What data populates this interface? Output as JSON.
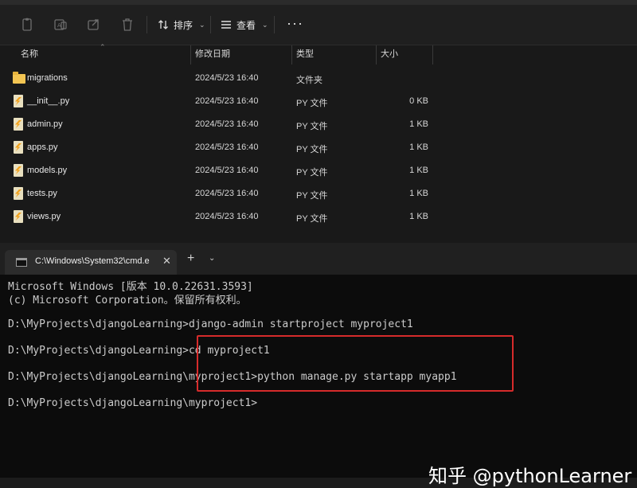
{
  "toolbar": {
    "icons": [
      "cut-icon",
      "copy-icon",
      "share-icon",
      "delete-icon"
    ],
    "sort_label": "排序",
    "view_label": "查看",
    "more_label": "···"
  },
  "columns": {
    "name": "名称",
    "modified": "修改日期",
    "type": "类型",
    "size": "大小"
  },
  "files": [
    {
      "name": "migrations",
      "modified": "2024/5/23 16:40",
      "type": "文件夹",
      "size": "",
      "kind": "folder"
    },
    {
      "name": "__init__.py",
      "modified": "2024/5/23 16:40",
      "type": "PY 文件",
      "size": "0 KB",
      "kind": "py"
    },
    {
      "name": "admin.py",
      "modified": "2024/5/23 16:40",
      "type": "PY 文件",
      "size": "1 KB",
      "kind": "py"
    },
    {
      "name": "apps.py",
      "modified": "2024/5/23 16:40",
      "type": "PY 文件",
      "size": "1 KB",
      "kind": "py"
    },
    {
      "name": "models.py",
      "modified": "2024/5/23 16:40",
      "type": "PY 文件",
      "size": "1 KB",
      "kind": "py"
    },
    {
      "name": "tests.py",
      "modified": "2024/5/23 16:40",
      "type": "PY 文件",
      "size": "1 KB",
      "kind": "py"
    },
    {
      "name": "views.py",
      "modified": "2024/5/23 16:40",
      "type": "PY 文件",
      "size": "1 KB",
      "kind": "py"
    }
  ],
  "terminal": {
    "tab_title": "C:\\Windows\\System32\\cmd.e",
    "close_label": "✕",
    "new_tab_label": "+",
    "dropdown_label": "⌄",
    "lines": [
      "Microsoft Windows [版本 10.0.22631.3593]",
      "(c) Microsoft Corporation。保留所有权利。",
      "",
      "D:\\MyProjects\\djangoLearning>django-admin startproject myproject1",
      "",
      "D:\\MyProjects\\djangoLearning>cd myproject1",
      "",
      "D:\\MyProjects\\djangoLearning\\myproject1>python manage.py startapp myapp1",
      "",
      "D:\\MyProjects\\djangoLearning\\myproject1>"
    ]
  },
  "highlight_color": "#d62b2b",
  "watermark": "知乎 @pythonLearner"
}
